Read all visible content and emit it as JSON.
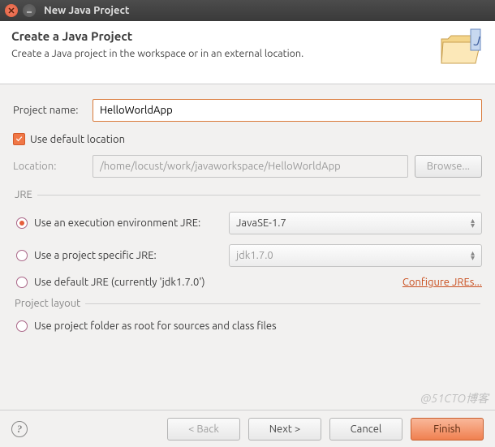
{
  "window": {
    "title": "New Java Project"
  },
  "header": {
    "title": "Create a Java Project",
    "subtitle": "Create a Java project in the workspace or in an external location."
  },
  "form": {
    "projectNameLabel": "Project name:",
    "projectNameValue": "HelloWorldApp",
    "useDefaultLocationLabel": "Use default location",
    "locationLabel": "Location:",
    "locationValue": "/home/locust/work/javaworkspace/HelloWorldApp",
    "browseLabel": "Browse..."
  },
  "jre": {
    "legend": "JRE",
    "opt1Label": "Use an execution environment JRE:",
    "opt1Value": "JavaSE-1.7",
    "opt2Label": "Use a project specific JRE:",
    "opt2Value": "jdk1.7.0",
    "opt3Label": "Use default JRE (currently 'jdk1.7.0')",
    "configureLink": "Configure JREs..."
  },
  "layout": {
    "legend": "Project layout",
    "opt1Label": "Use project folder as root for sources and class files"
  },
  "footer": {
    "back": "< Back",
    "next": "Next >",
    "cancel": "Cancel",
    "finish": "Finish"
  },
  "watermark": "@51CTO博客"
}
